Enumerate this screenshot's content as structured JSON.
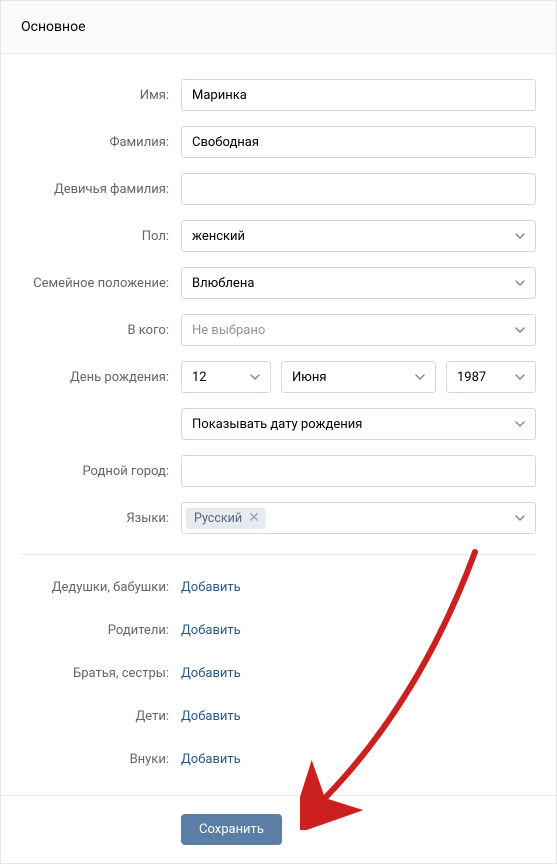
{
  "header": {
    "title": "Основное"
  },
  "labels": {
    "first_name": "Имя:",
    "last_name": "Фамилия:",
    "maiden_name": "Девичья фамилия:",
    "gender": "Пол:",
    "relationship": "Семейное положение:",
    "partner": "В кого:",
    "birthday": "День рождения:",
    "hometown": "Родной город:",
    "languages": "Языки:"
  },
  "values": {
    "first_name": "Маринка",
    "last_name": "Свободная",
    "maiden_name": "",
    "gender": "женский",
    "relationship": "Влюблена",
    "partner": "Не выбрано",
    "birth_day": "12",
    "birth_month": "Июня",
    "birth_year": "1987",
    "birthday_visibility": "Показывать дату рождения",
    "hometown": ""
  },
  "languages": {
    "items": [
      {
        "label": "Русский"
      }
    ]
  },
  "relatives": {
    "grandparents": {
      "label": "Дедушки, бабушки:",
      "action": "Добавить"
    },
    "parents": {
      "label": "Родители:",
      "action": "Добавить"
    },
    "siblings": {
      "label": "Братья, сестры:",
      "action": "Добавить"
    },
    "children": {
      "label": "Дети:",
      "action": "Добавить"
    },
    "grandchildren": {
      "label": "Внуки:",
      "action": "Добавить"
    }
  },
  "footer": {
    "save_label": "Сохранить"
  }
}
